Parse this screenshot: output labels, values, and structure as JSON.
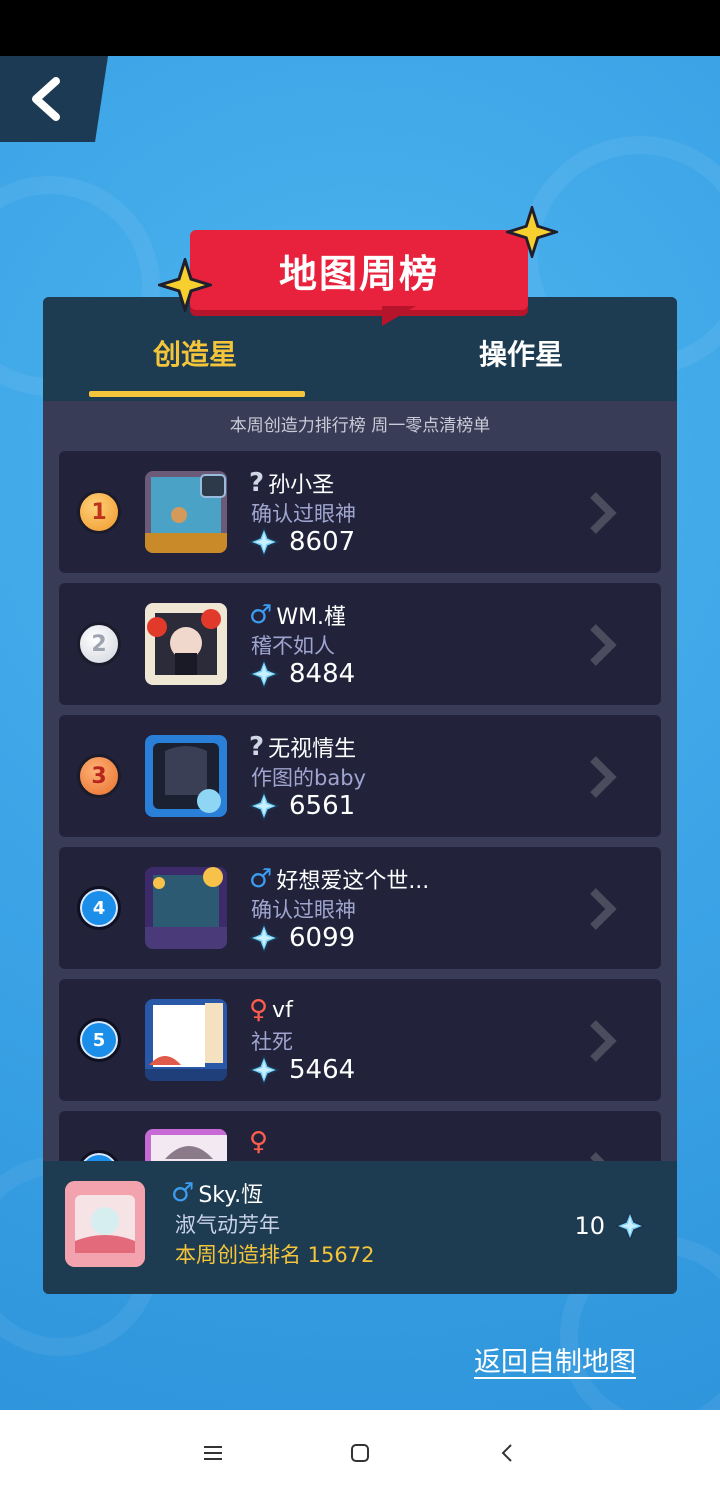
{
  "header": {
    "banner_title": "地图周榜"
  },
  "tabs": [
    {
      "label": "创造星",
      "active": true
    },
    {
      "label": "操作星",
      "active": false
    }
  ],
  "subtitle": "本周创造力排行榜 周一零点清榜单",
  "colors": {
    "accent": "#f4c53a",
    "banner": "#e8213c",
    "panel": "#2a2e45",
    "header": "#1e3c51",
    "male": "#3b9cf0",
    "female": "#ff5e4d"
  },
  "leaderboard": [
    {
      "rank": "1",
      "gender_symbol": "?",
      "name": "孙小圣",
      "title": "确认过眼神",
      "score": "8607"
    },
    {
      "rank": "2",
      "gender_symbol": "♂",
      "name": "WM.槿",
      "title": "稽不如人",
      "score": "8484"
    },
    {
      "rank": "3",
      "gender_symbol": "?",
      "name": "无视情生",
      "title": "作图的baby",
      "score": "6561"
    },
    {
      "rank": "4",
      "gender_symbol": "♂",
      "name": "好想爱这个世...",
      "title": "确认过眼神",
      "score": "6099"
    },
    {
      "rank": "5",
      "gender_symbol": "♀",
      "name": "vf",
      "title": "社死",
      "score": "5464"
    },
    {
      "rank": "6",
      "gender_symbol": "♀",
      "name": "",
      "title": "",
      "score": ""
    }
  ],
  "me": {
    "gender_symbol": "♂",
    "name": "Sky.恆",
    "title": "淑气动芳年",
    "rank_text": "本周创造排名 15672",
    "score": "10"
  },
  "footer": {
    "return_link": "返回自制地图"
  },
  "icons": {
    "back": "back-arrow-icon",
    "diamond": "crystal-icon",
    "chevron": "chevron-right-icon",
    "star": "sparkle-star-icon"
  }
}
